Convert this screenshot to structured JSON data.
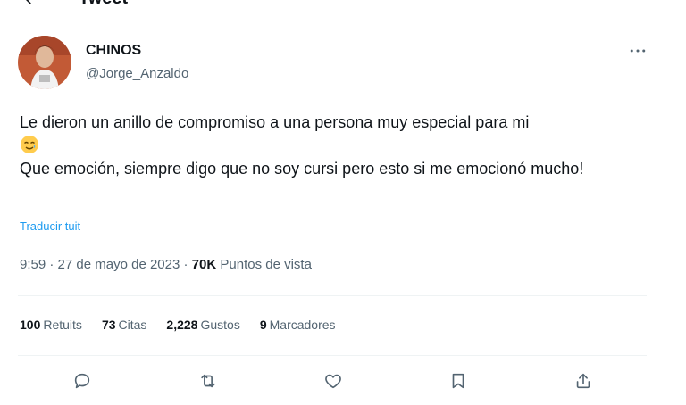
{
  "header": {
    "title": "Tweet",
    "back_icon": "back-arrow-icon"
  },
  "author": {
    "name": "CHINOS",
    "handle": "@Jorge_Anzaldo"
  },
  "tweet": {
    "line1": "Le dieron un anillo de compromiso a una persona muy especial para mi",
    "emoji": "smiling-face-with-tear-emoji",
    "line2": "Que emoción, siempre digo que no soy cursi pero esto si me emocionó mucho!"
  },
  "translate_link": "Traducir tuit",
  "meta": {
    "time": "9:59",
    "sep1": " · ",
    "date": "27 de mayo de 2023",
    "sep2": " · ",
    "views_count": "70K",
    "views_label": "Puntos de vista"
  },
  "stats": [
    {
      "count": "100",
      "label": "Retuits"
    },
    {
      "count": "73",
      "label": "Citas"
    },
    {
      "count": "2,228",
      "label": "Gustos"
    },
    {
      "count": "9",
      "label": "Marcadores"
    }
  ],
  "actions": [
    "reply-icon",
    "retweet-icon",
    "like-icon",
    "bookmark-icon",
    "share-icon"
  ],
  "colors": {
    "link": "#1d9bf0",
    "secondary_text": "#536471",
    "primary_text": "#0f1419",
    "divider": "#eff3f4"
  }
}
